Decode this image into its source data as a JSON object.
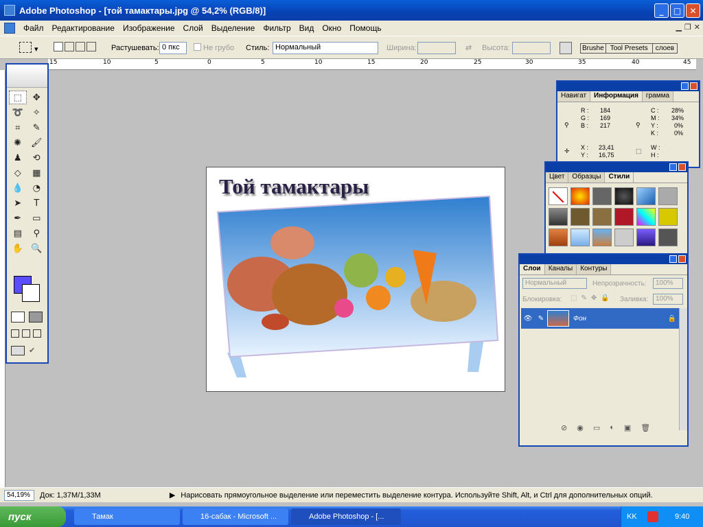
{
  "title": "Adobe Photoshop - [той тамактары.jpg @ 54,2% (RGB/8)]",
  "menu": [
    "Файл",
    "Редактирование",
    "Изображение",
    "Слой",
    "Выделение",
    "Фильтр",
    "Вид",
    "Окно",
    "Помощь"
  ],
  "options": {
    "feather_label": "Растушевать:",
    "feather_value": "0 пкс",
    "antialias_label": "Не грубо",
    "style_label": "Стиль:",
    "style_value": "Нормальный",
    "width_label": "Ширина:",
    "height_label": "Высота:",
    "brushes_tab": "Brushe",
    "toolpresets_tab": "Tool Presets",
    "layers_tab": "слоев"
  },
  "ruler_ticks": [
    "15",
    "10",
    "5",
    "0",
    "5",
    "10",
    "15",
    "20",
    "25",
    "30",
    "35",
    "40",
    "45"
  ],
  "canvas_heading": "Той тамактары",
  "info_panel": {
    "tabs": [
      "Навигат",
      "Информация",
      "грамма"
    ],
    "r_label": "R :",
    "r": "184",
    "g_label": "G :",
    "g": "169",
    "b_label": "B :",
    "b": "217",
    "c_label": "C :",
    "c": "28%",
    "m_label": "M :",
    "m": "34%",
    "y_label": "Y :",
    "y": "0%",
    "k_label": "K :",
    "k": "0%",
    "x_label": "X :",
    "x": "23,41",
    "yy_label": "Y :",
    "yy": "16,75",
    "w_label": "W :",
    "h_label": "H :"
  },
  "styles_panel": {
    "tabs": [
      "Цвет",
      "Образцы",
      "Стили"
    ]
  },
  "layers_panel": {
    "tabs": [
      "Слои",
      "Каналы",
      "Контуры"
    ],
    "blend_mode": "Нормальный",
    "opacity_label": "Непрозрачность:",
    "opacity_value": "100%",
    "lock_label": "Блокировка:",
    "fill_label": "Заливка:",
    "fill_value": "100%",
    "layer_name": "Фон"
  },
  "status": {
    "zoom": "54,19%",
    "doc": "Док: 1,37M/1,33M",
    "hint": "Нарисовать прямоугольное выделение или переместить выделение контура.  Используйте Shift, Alt, и Ctrl для дополнительных опций."
  },
  "taskbar": {
    "start": "пуск",
    "tasks": [
      "Тамак",
      "16-сабак - Microsoft ...",
      "Adobe Photoshop - [..."
    ],
    "lang": "KK",
    "time": "9:40"
  }
}
